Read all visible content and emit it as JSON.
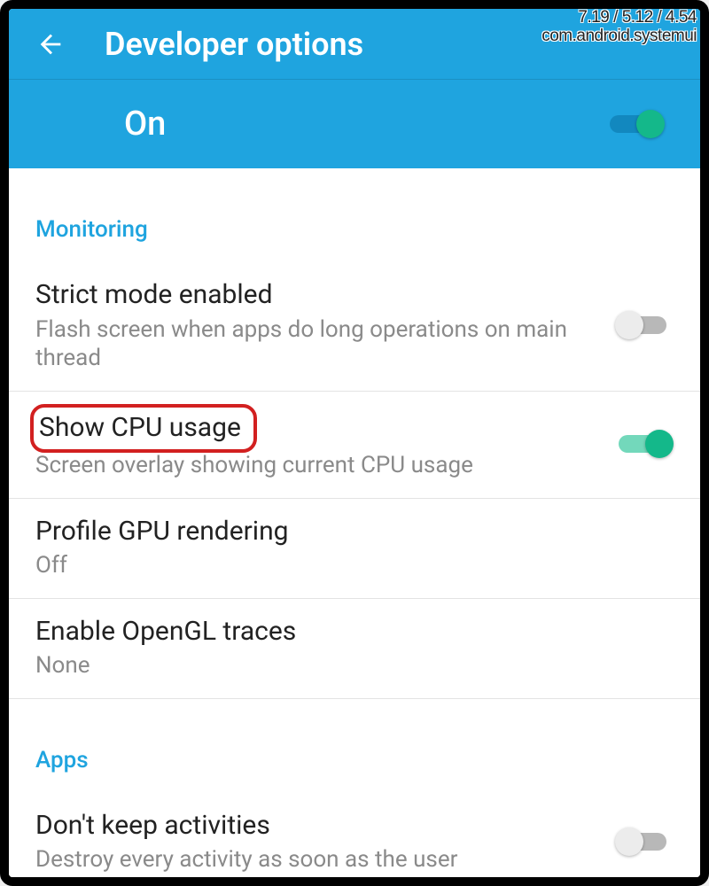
{
  "overlay": {
    "line1": "7.19 / 5.12 / 4.54",
    "line2": "com.android.systemui"
  },
  "header": {
    "title": "Developer options"
  },
  "master": {
    "label": "On",
    "state": "on"
  },
  "sections": [
    {
      "header": "Monitoring",
      "items": [
        {
          "title": "Strict mode enabled",
          "sub": "Flash screen when apps do long operations on main thread",
          "toggle": "off",
          "highlight": false
        },
        {
          "title": "Show CPU usage",
          "sub": "Screen overlay showing current CPU usage",
          "toggle": "on",
          "highlight": true
        },
        {
          "title": "Profile GPU rendering",
          "sub": "Off",
          "toggle": null,
          "highlight": false
        },
        {
          "title": "Enable OpenGL traces",
          "sub": "None",
          "toggle": null,
          "highlight": false
        }
      ]
    },
    {
      "header": "Apps",
      "items": [
        {
          "title": "Don't keep activities",
          "sub": "Destroy every activity as soon as the user",
          "toggle": "off",
          "highlight": false
        }
      ]
    }
  ]
}
